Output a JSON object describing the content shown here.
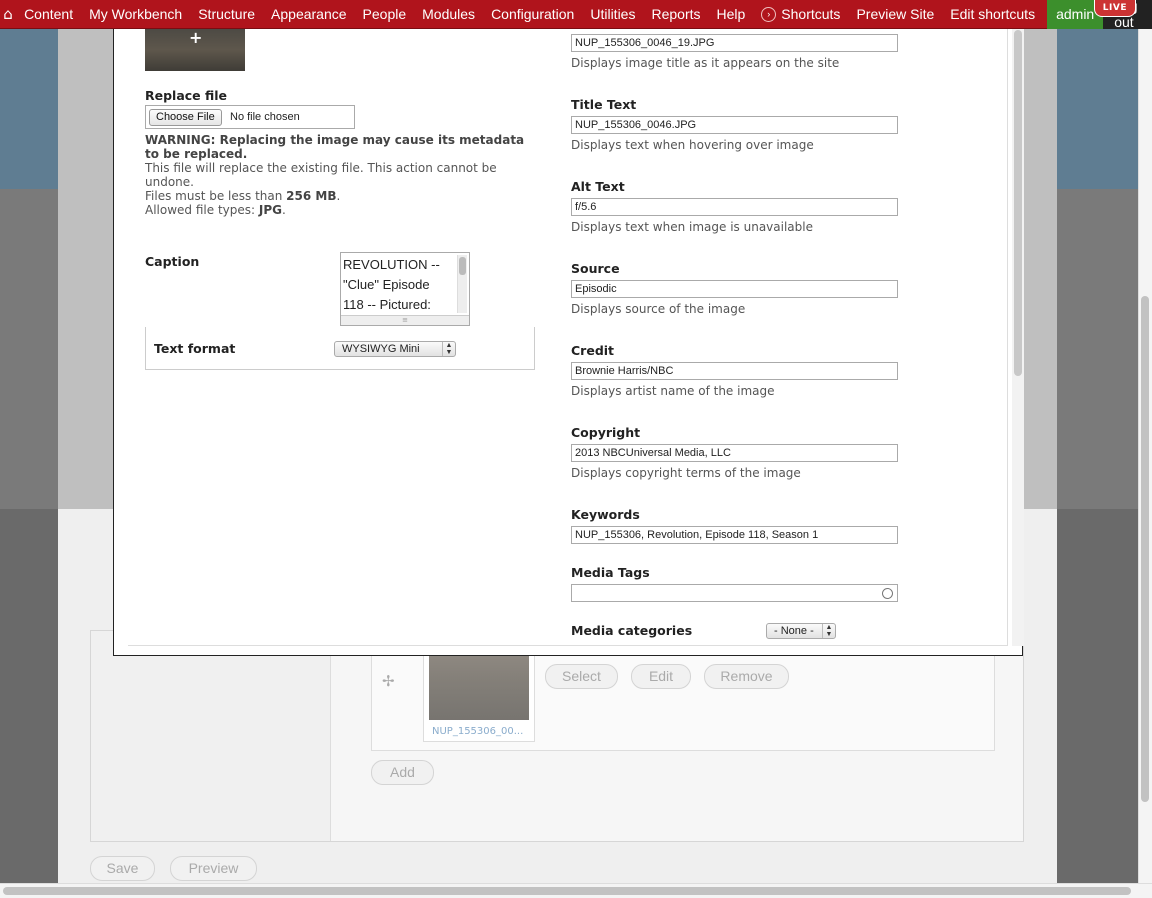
{
  "toolbar": {
    "items": [
      "Content",
      "My Workbench",
      "Structure",
      "Appearance",
      "People",
      "Modules",
      "Configuration",
      "Utilities",
      "Reports",
      "Help"
    ],
    "shortcuts": "Shortcuts",
    "preview_site": "Preview Site",
    "edit_shortcuts": "Edit shortcuts",
    "admin": "admin",
    "logout": "Log out",
    "live_badge": "LIVE"
  },
  "modal": {
    "replace_file": {
      "label": "Replace file",
      "button": "Choose File",
      "status": "No file chosen"
    },
    "warning": {
      "bold": "WARNING: Replacing the image may cause its metadata to be replaced.",
      "line1": "This file will replace the existing file. This action cannot be undone.",
      "size_prefix": "Files must be less than ",
      "size_value": "256 MB",
      "size_suffix": ".",
      "types_prefix": "Allowed file types: ",
      "types_value": "JPG",
      "types_suffix": "."
    },
    "caption": {
      "label": "Caption",
      "value": "REVOLUTION -- \"Clue\" Episode 118 -- Pictured:"
    },
    "text_format": {
      "label": "Text format",
      "value": "WYSIWYG Mini"
    },
    "fields": [
      {
        "label": "",
        "value": "NUP_155306_0046_19.JPG",
        "desc": "Displays image title as it appears on the site"
      },
      {
        "label": "Title Text",
        "value": "NUP_155306_0046.JPG",
        "desc": "Displays text when hovering over image"
      },
      {
        "label": "Alt Text",
        "value": "f/5.6",
        "desc": "Displays text when image is unavailable"
      },
      {
        "label": "Source",
        "value": "Episodic",
        "desc": "Displays source of the image"
      },
      {
        "label": "Credit",
        "value": "Brownie Harris/NBC",
        "desc": "Displays artist name of the image"
      },
      {
        "label": "Copyright",
        "value": "2013 NBCUniversal Media, LLC",
        "desc": "Displays copyright terms of the image"
      },
      {
        "label": "Keywords",
        "value": "NUP_155306, Revolution, Episode 118, Season 1",
        "desc": ""
      }
    ],
    "media_tags": {
      "label": "Media Tags",
      "value": ""
    },
    "media_categories": {
      "label": "Media categories",
      "value": "- None -"
    }
  },
  "background": {
    "thumb_filename": "NUP_155306_00...",
    "select_btn": "Select",
    "edit_btn": "Edit",
    "remove_btn": "Remove",
    "add_btn": "Add",
    "save_btn": "Save",
    "preview_btn": "Preview"
  }
}
